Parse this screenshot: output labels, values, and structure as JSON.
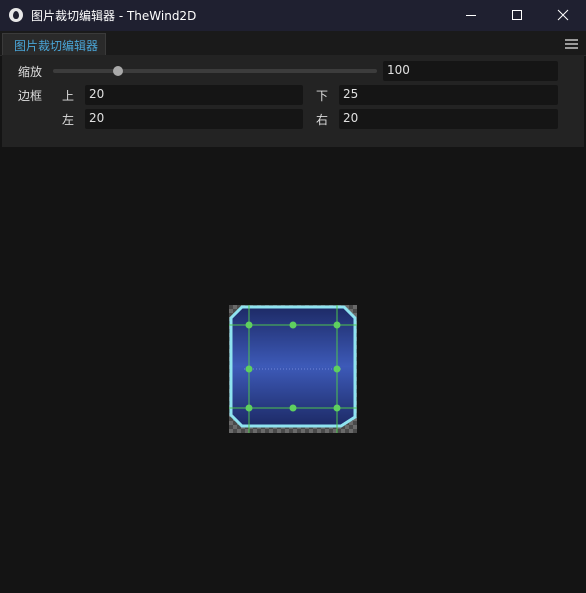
{
  "window": {
    "title": "图片裁切编辑器 - TheWind2D"
  },
  "tabs": [
    {
      "label": "图片裁切编辑器",
      "active": true
    }
  ],
  "zoom": {
    "label": "缩放",
    "value": "100",
    "slider_fraction": 0.2
  },
  "border": {
    "label": "边框",
    "top": {
      "label": "上",
      "value": "20"
    },
    "bottom": {
      "label": "下",
      "value": "25"
    },
    "left": {
      "label": "左",
      "value": "20"
    },
    "right": {
      "label": "右",
      "value": "20"
    }
  },
  "colors": {
    "titlebar": "#1f2030",
    "tab_text": "#4aa6d8",
    "canvas_bg": "#141414",
    "frame_outline": "#8fe3f0",
    "guide_lines": "#4ec44e",
    "image_fill_top": "#1d2a66",
    "image_fill_mid": "#3d5ab8"
  },
  "icons": [
    "app-logo-icon",
    "minimize-icon",
    "maximize-icon",
    "close-icon",
    "hamburger-menu-icon"
  ]
}
